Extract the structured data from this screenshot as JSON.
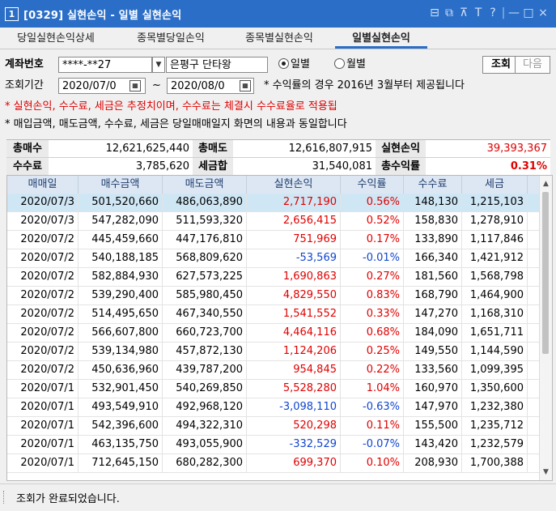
{
  "window": {
    "number": "1",
    "title": "[0329] 실현손익 - 일별 실현손익",
    "controls": [
      "⊟",
      "⧉",
      "⊼",
      "T",
      "?",
      "|",
      "—",
      "□",
      "×"
    ]
  },
  "tabs": [
    {
      "label": "당일실현손익상세",
      "active": false
    },
    {
      "label": "종목별당일손익",
      "active": false
    },
    {
      "label": "종목별실현손익",
      "active": false
    },
    {
      "label": "일별실현손익",
      "active": true
    }
  ],
  "form": {
    "account_label": "계좌번호",
    "account_value": "****-**27",
    "branch_value": "은평구 단타왕",
    "radio_daily": "일별",
    "radio_monthly": "월별",
    "selected_radio": "daily",
    "search_button": "조회",
    "next_button": "다음",
    "period_label": "조회기간",
    "date_from": "2020/07/0",
    "date_sep": "~",
    "date_to": "2020/08/0",
    "period_note": "* 수익률의 경우 2016년 3월부터 제공됩니다"
  },
  "notes": {
    "red": "* 실현손익, 수수료, 세금은 추정치이며, 수수료는 체결시 수수료율로 적용됩",
    "black": "* 매입금액, 매도금액, 수수료, 세금은 당일매매일지 화면의 내용과 동일합니다"
  },
  "summary": {
    "row1": [
      {
        "label": "총매수",
        "value": "12,621,625,440"
      },
      {
        "label": "총매도",
        "value": "12,616,807,915"
      },
      {
        "label": "실현손익",
        "value": "39,393,367"
      }
    ],
    "row2": [
      {
        "label": "수수료",
        "value": "3,785,620"
      },
      {
        "label": "세금합",
        "value": "31,540,081"
      },
      {
        "label": "총수익률",
        "value": "0.31%"
      }
    ]
  },
  "table": {
    "columns": [
      "매매일",
      "매수금액",
      "매도금액",
      "실현손익",
      "수익률",
      "수수료",
      "세금"
    ],
    "rows": [
      [
        "2020/07/3",
        "501,520,660",
        "486,063,890",
        "2,717,190",
        "0.56%",
        "148,130",
        "1,215,103"
      ],
      [
        "2020/07/3",
        "547,282,090",
        "511,593,320",
        "2,656,415",
        "0.52%",
        "158,830",
        "1,278,910"
      ],
      [
        "2020/07/2",
        "445,459,660",
        "447,176,810",
        "751,969",
        "0.17%",
        "133,890",
        "1,117,846"
      ],
      [
        "2020/07/2",
        "540,188,185",
        "568,809,620",
        "-53,569",
        "-0.01%",
        "166,340",
        "1,421,912"
      ],
      [
        "2020/07/2",
        "582,884,930",
        "627,573,225",
        "1,690,863",
        "0.27%",
        "181,560",
        "1,568,798"
      ],
      [
        "2020/07/2",
        "539,290,400",
        "585,980,450",
        "4,829,550",
        "0.83%",
        "168,790",
        "1,464,900"
      ],
      [
        "2020/07/2",
        "514,495,650",
        "467,340,550",
        "1,541,552",
        "0.33%",
        "147,270",
        "1,168,310"
      ],
      [
        "2020/07/2",
        "566,607,800",
        "660,723,700",
        "4,464,116",
        "0.68%",
        "184,090",
        "1,651,711"
      ],
      [
        "2020/07/2",
        "539,134,980",
        "457,872,130",
        "1,124,206",
        "0.25%",
        "149,550",
        "1,144,590"
      ],
      [
        "2020/07/2",
        "450,636,960",
        "439,787,200",
        "954,845",
        "0.22%",
        "133,560",
        "1,099,395"
      ],
      [
        "2020/07/1",
        "532,901,450",
        "540,269,850",
        "5,528,280",
        "1.04%",
        "160,970",
        "1,350,600"
      ],
      [
        "2020/07/1",
        "493,549,910",
        "492,968,120",
        "-3,098,110",
        "-0.63%",
        "147,970",
        "1,232,380"
      ],
      [
        "2020/07/1",
        "542,396,600",
        "494,322,310",
        "520,298",
        "0.11%",
        "155,500",
        "1,235,712"
      ],
      [
        "2020/07/1",
        "463,135,750",
        "493,055,900",
        "-332,529",
        "-0.07%",
        "143,420",
        "1,232,579"
      ],
      [
        "2020/07/1",
        "712,645,150",
        "680,282,300",
        "699,370",
        "0.10%",
        "208,930",
        "1,700,388"
      ]
    ],
    "selected_row": 0
  },
  "status": {
    "message": "조회가 완료되었습니다."
  },
  "colors": {
    "titlebar": "#2b6ec7",
    "profit": "#e00000",
    "loss": "#1045d0",
    "selected_row": "#cfe6f4",
    "header_bg": "#dde7f3"
  }
}
